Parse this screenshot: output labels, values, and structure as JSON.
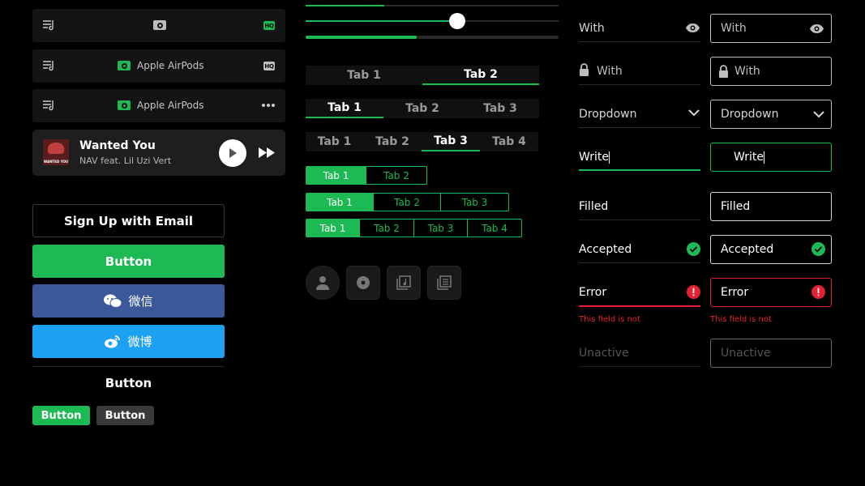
{
  "device_rows": [
    {
      "device": "",
      "badge": "HQ",
      "badge_color": "#1db954"
    },
    {
      "device": "Apple AirPods",
      "badge": "HQ",
      "badge_color": "#bdbdbd"
    },
    {
      "device": "Apple AirPods",
      "badge": "more"
    }
  ],
  "player": {
    "title": "Wanted You",
    "artist": "NAV feat. Lil Uzi Vert",
    "cover_text": "WANTED YOU"
  },
  "buttons": {
    "signup": "Sign Up with Email",
    "primary": "Button",
    "wechat": "微信",
    "weibo": "微博",
    "text": "Button",
    "small_green": "Button",
    "small_gray": "Button"
  },
  "tabs": {
    "bar1": [
      "Tab 1",
      "Tab 2"
    ],
    "bar2": [
      "Tab 1",
      "Tab 2",
      "Tab 3"
    ],
    "bar3": [
      "Tab 1",
      "Tab 2",
      "Tab 3",
      "Tab 4"
    ]
  },
  "segments": {
    "seg1": [
      "Tab 1",
      "Tab 2"
    ],
    "seg2": [
      "Tab 1",
      "Tab 2",
      "Tab 3"
    ],
    "seg3": [
      "Tab 1",
      "Tab 2",
      "Tab 3",
      "Tab 4"
    ]
  },
  "slider": {
    "value": 0.6
  },
  "progress": {
    "value": 0.44
  },
  "fields": {
    "password": "With",
    "locked": "With",
    "dropdown": "Dropdown",
    "write": "Write",
    "filled": "Filled",
    "accepted": "Accepted",
    "error": "Error",
    "error_msg": "This field is not",
    "unactive": "Unactive"
  },
  "colors": {
    "accent": "#1db954",
    "error": "#e22134",
    "wechat": "#3b5998",
    "weibo": "#1da1f2"
  }
}
